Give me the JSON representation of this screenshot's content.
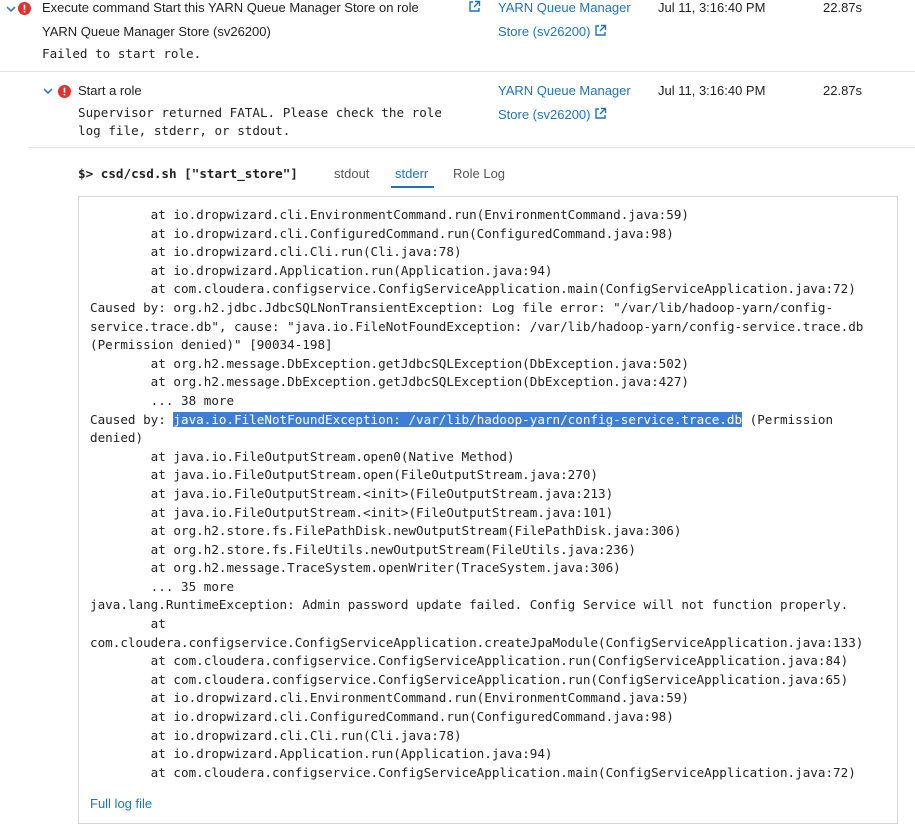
{
  "commands": [
    {
      "title": "Execute command Start this YARN Queue Manager Store on role",
      "title_line2": "YARN Queue Manager Store (sv26200)",
      "message": "Failed to start role.",
      "role_link_line1": "YARN Queue Manager",
      "role_link_line2": "Store (sv26200)",
      "time": "Jul 11, 3:16:40 PM",
      "duration": "22.87s"
    },
    {
      "title": "Start a role",
      "message_line1": "Supervisor returned FATAL. Please check the role",
      "message_line2": "log file, stderr, or stdout.",
      "role_link_line1": "YARN Queue Manager",
      "role_link_line2": "Store (sv26200)",
      "time": "Jul 11, 3:16:40 PM",
      "duration": "22.87s"
    }
  ],
  "details": {
    "command_prompt": "$> csd/csd.sh [\"start_store\"]",
    "tabs": [
      {
        "label": "stdout",
        "active": false
      },
      {
        "label": "stderr",
        "active": true
      },
      {
        "label": "Role Log",
        "active": false
      }
    ],
    "log_lines": [
      "        at io.dropwizard.cli.EnvironmentCommand.run(EnvironmentCommand.java:59)",
      "        at io.dropwizard.cli.ConfiguredCommand.run(ConfiguredCommand.java:98)",
      "        at io.dropwizard.cli.Cli.run(Cli.java:78)",
      "        at io.dropwizard.Application.run(Application.java:94)",
      "        at com.cloudera.configservice.ConfigServiceApplication.main(ConfigServiceApplication.java:72)",
      "Caused by: org.h2.jdbc.JdbcSQLNonTransientException: Log file error: \"/var/lib/hadoop-yarn/config-",
      "service.trace.db\", cause: \"java.io.FileNotFoundException: /var/lib/hadoop-yarn/config-service.trace.db",
      "(Permission denied)\" [90034-198]",
      "        at org.h2.message.DbException.getJdbcSQLException(DbException.java:502)",
      "        at org.h2.message.DbException.getJdbcSQLException(DbException.java:427)",
      "        ... 38 more",
      "",
      "denied)",
      "        at java.io.FileOutputStream.open0(Native Method)",
      "        at java.io.FileOutputStream.open(FileOutputStream.java:270)",
      "        at java.io.FileOutputStream.<init>(FileOutputStream.java:213)",
      "        at java.io.FileOutputStream.<init>(FileOutputStream.java:101)",
      "        at org.h2.store.fs.FilePathDisk.newOutputStream(FilePathDisk.java:306)",
      "        at org.h2.store.fs.FileUtils.newOutputStream(FileUtils.java:236)",
      "        at org.h2.message.TraceSystem.openWriter(TraceSystem.java:306)",
      "        ... 35 more",
      "java.lang.RuntimeException: Admin password update failed. Config Service will not function properly.",
      "        at",
      "com.cloudera.configservice.ConfigServiceApplication.createJpaModule(ConfigServiceApplication.java:133)",
      "        at com.cloudera.configservice.ConfigServiceApplication.run(ConfigServiceApplication.java:84)",
      "        at com.cloudera.configservice.ConfigServiceApplication.run(ConfigServiceApplication.java:65)",
      "        at io.dropwizard.cli.EnvironmentCommand.run(EnvironmentCommand.java:59)",
      "        at io.dropwizard.cli.ConfiguredCommand.run(ConfiguredCommand.java:98)",
      "        at io.dropwizard.cli.Cli.run(Cli.java:78)",
      "        at io.dropwizard.Application.run(Application.java:94)",
      "        at com.cloudera.configservice.ConfigServiceApplication.main(ConfigServiceApplication.java:72)"
    ],
    "highlighted_line": {
      "prefix": "Caused by: ",
      "selected": "java.io.FileNotFoundException: /var/lib/hadoop-yarn/config-service.trace.db",
      "suffix": " (Permission"
    },
    "full_log_link": "Full log file"
  },
  "colors": {
    "link": "#1e73be",
    "error": "#e03030",
    "selection": "#3d7fd6"
  },
  "icons": {
    "expand": "chevron-down-icon",
    "error": "error-circle-icon",
    "external": "external-link-icon"
  }
}
